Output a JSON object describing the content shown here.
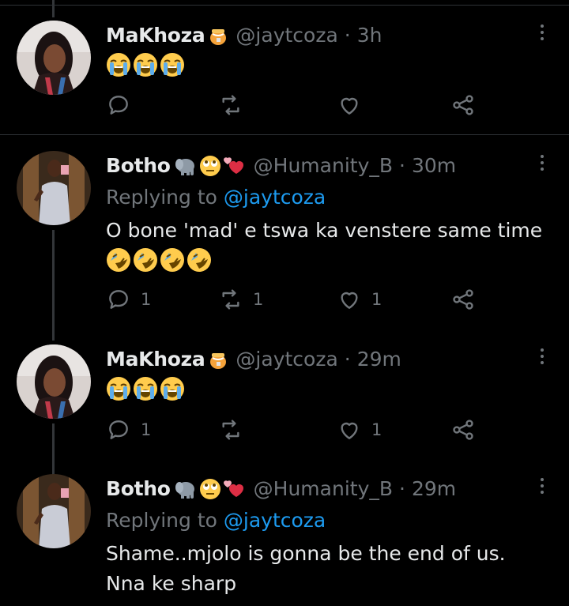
{
  "tweets": [
    {
      "name": "MaKhoza",
      "handle": "@jaytcoza",
      "separator": "·",
      "time": "3h",
      "body": "",
      "replying_label": "",
      "replying_to": "",
      "emoji": [
        "loudly-crying-face",
        "loudly-crying-face",
        "loudly-crying-face"
      ],
      "counts": {
        "reply": "",
        "retweet": "",
        "like": ""
      }
    },
    {
      "name": "Botho",
      "handle": "@Humanity_B",
      "separator": "·",
      "time": "30m",
      "replying_label": "Replying to",
      "replying_to": "@jaytcoza",
      "body": "O bone 'mad' e tswa ka venstere same time",
      "emoji": [
        "rolling-on-floor-laughing",
        "rolling-on-floor-laughing",
        "rolling-on-floor-laughing",
        "rolling-on-floor-laughing"
      ],
      "counts": {
        "reply": "1",
        "retweet": "1",
        "like": "1"
      }
    },
    {
      "name": "MaKhoza",
      "handle": "@jaytcoza",
      "separator": "·",
      "time": "29m",
      "body": "",
      "replying_label": "",
      "replying_to": "",
      "emoji": [
        "loudly-crying-face",
        "loudly-crying-face",
        "loudly-crying-face"
      ],
      "counts": {
        "reply": "1",
        "retweet": "",
        "like": "1"
      }
    },
    {
      "name": "Botho",
      "handle": "@Humanity_B",
      "separator": "·",
      "time": "29m",
      "replying_label": "Replying to",
      "replying_to": "@jaytcoza",
      "body": "Shame..mjolo is gonna be the end of us. Nna ke sharp",
      "emoji": [],
      "counts": {
        "reply": "",
        "retweet": "",
        "like": ""
      }
    }
  ],
  "badges": {
    "makhoza": [
      "honey-pot-icon"
    ],
    "botho": [
      "elephant-icon",
      "face-with-rolling-eyes-icon",
      "revolving-hearts-icon"
    ]
  },
  "colors": {
    "background": "#000000",
    "text": "#e7e9ea",
    "muted": "#71767b",
    "link": "#1d9bf0",
    "divider": "#2f3336"
  }
}
